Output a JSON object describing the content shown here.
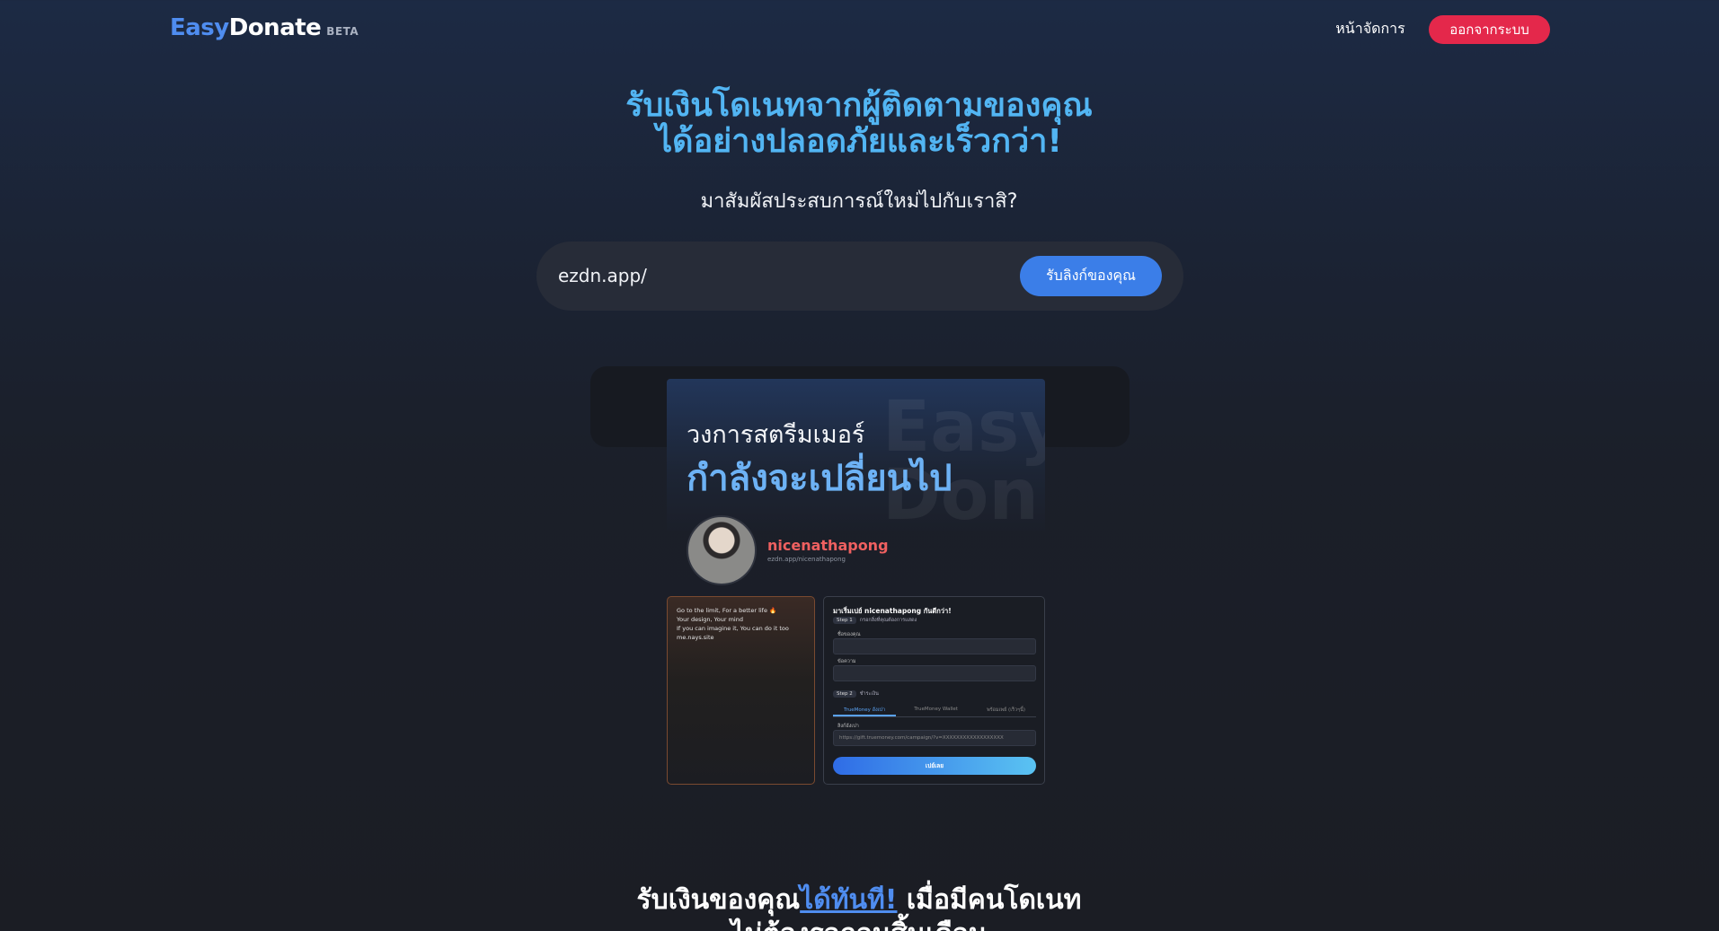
{
  "header": {
    "brand_easy": "Easy",
    "brand_donate": "Donate",
    "brand_badge": "BETA",
    "nav_manage": "หน้าจัดการ",
    "logout_label": "ออกจากระบบ"
  },
  "hero": {
    "title_line1": "รับเงินโดเนทจากผู้ติดตามของคุณ",
    "title_line2": "ได้อย่างปลอดภัยและเร็วกว่า!",
    "subtitle": "มาสัมผัสประสบการณ์ใหม่ไปกับเราสิ?",
    "link_prefix": "ezdn.app/",
    "link_value": "",
    "get_link_label": "รับลิงก์ของคุณ"
  },
  "preview": {
    "banner_line1": "วงการสตรีมเมอร์",
    "banner_line2": "กำลังจะเปลี่ยนไป",
    "banner_watermark_1": "Easy",
    "banner_watermark_2": "Don",
    "streamer_name": "nicenathapong",
    "streamer_url": "ezdn.app/nicenathapong",
    "left_card_lines": [
      "Go to the limit, For a better life 🔥",
      "Your design, Your mind",
      "If you can imagine it, You can do it too",
      "me.nays.site"
    ],
    "form_title": "มาเริ่มเปย์ nicenathapong กันดีกว่า!",
    "step1_pill": "Step 1",
    "step1_text": "กรอกสิ่งที่คุณต้องการแสดง",
    "field1_label": "ชื่อของคุณ",
    "field2_label": "ข้อความ",
    "step2_pill": "Step 2",
    "step2_text": "ชำระเงิน",
    "tabs": [
      "TrueMoney อังเปา",
      "TrueMoney Wallet",
      "พร้อมเพย์ (เร็วๆนี้)"
    ],
    "url_label": "ลิงก์อังเปา",
    "url_placeholder": "https://gift.truemoney.com/campaign/?v=XXXXXXXXXXXXXXXXXX",
    "pay_button": "เปย์เลย"
  },
  "bottom": {
    "heading_part1": "รับเงินของคุณ",
    "heading_highlight": "ได้ทันที!",
    "heading_part2": " เมื่อมีคนโดเนท",
    "heading_line2": "ไม่ต้องรอถอนสิ้นเดือน"
  },
  "colors": {
    "accent_blue": "#4f8df0",
    "hero_title": "#52b5f3",
    "logout_red": "#e4284b",
    "button_blue": "#3b7ee8"
  }
}
